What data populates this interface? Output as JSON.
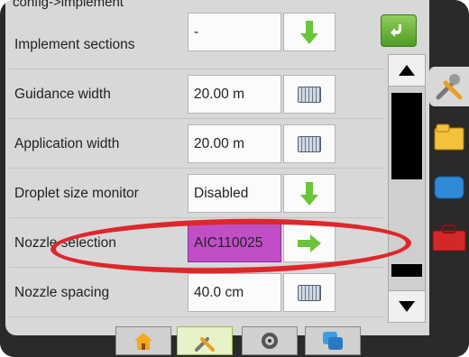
{
  "breadcrumb": "config->implement",
  "rows": [
    {
      "label": "Implement sections",
      "value": "-",
      "action": "dropdown-icon"
    },
    {
      "label": "Guidance width",
      "value": "20.00 m",
      "action": "keyboard-icon"
    },
    {
      "label": "Application width",
      "value": "20.00 m",
      "action": "keyboard-icon"
    },
    {
      "label": "Droplet size monitor",
      "value": "Disabled",
      "action": "dropdown-icon"
    },
    {
      "label": "Nozzle selection",
      "value": "AIC110025",
      "action": "arrow-right-icon"
    },
    {
      "label": "Nozzle spacing",
      "value": "40.0 cm",
      "action": "keyboard-icon"
    }
  ],
  "colors": {
    "selected_field": "#c04fc6",
    "accent_green": "#5aa82a",
    "highlight_ring": "#e0262b"
  },
  "right_tabs": [
    "tools-icon",
    "folder-icon",
    "blue-display-icon",
    "toolbox-icon"
  ],
  "bottom_tabs": [
    "home-icon",
    "tools-icon",
    "gps-icon",
    "data-icon"
  ]
}
